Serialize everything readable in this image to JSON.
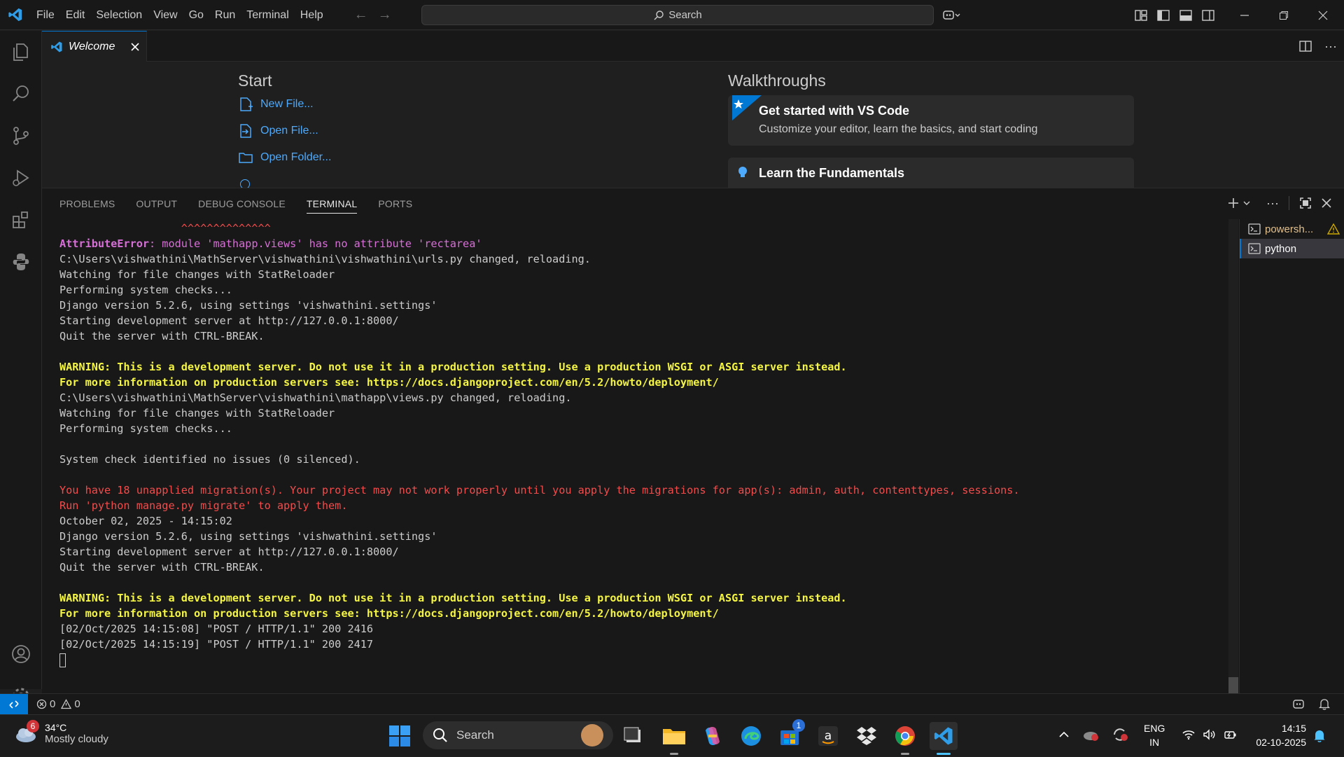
{
  "titlebar": {
    "menu": [
      "File",
      "Edit",
      "Selection",
      "View",
      "Go",
      "Run",
      "Terminal",
      "Help"
    ],
    "search_label": "Search"
  },
  "editor": {
    "tab_label": "Welcome",
    "start_title": "Start",
    "start_links": [
      "New File...",
      "Open File...",
      "Open Folder..."
    ],
    "walkthroughs_title": "Walkthroughs",
    "walkthroughs": [
      {
        "title": "Get started with VS Code",
        "desc": "Customize your editor, learn the basics, and start coding"
      },
      {
        "title": "Learn the Fundamentals",
        "desc": ""
      }
    ]
  },
  "panel": {
    "tabs": [
      "PROBLEMS",
      "OUTPUT",
      "DEBUG CONSOLE",
      "TERMINAL",
      "PORTS"
    ],
    "active_tab": "TERMINAL",
    "terminals": [
      "powersh...",
      "python"
    ],
    "lines": {
      "carets": "                   ^^^^^^^^^^^^^^",
      "err_name": "AttributeError",
      "err_msg": ": module 'mathapp.views' has no attribute 'rectarea'",
      "l1": "C:\\Users\\vishwathini\\MathServer\\vishwathini\\vishwathini\\urls.py changed, reloading.",
      "l2": "Watching for file changes with StatReloader",
      "l3": "Performing system checks...",
      "l4": "Django version 5.2.6, using settings 'vishwathini.settings'",
      "l5": "Starting development server at http://127.0.0.1:8000/",
      "l6": "Quit the server with CTRL-BREAK.",
      "w1": "WARNING: This is a development server. Do not use it in a production setting. Use a production WSGI or ASGI server instead.",
      "w2": "For more information on production servers see: https://docs.djangoproject.com/en/5.2/howto/deployment/",
      "l7": "C:\\Users\\vishwathini\\MathServer\\vishwathini\\mathapp\\views.py changed, reloading.",
      "l8": "Watching for file changes with StatReloader",
      "l9": "Performing system checks...",
      "l10": "System check identified no issues (0 silenced).",
      "m1": "You have 18 unapplied migration(s). Your project may not work properly until you apply the migrations for app(s): admin, auth, contenttypes, sessions.",
      "m2": "Run 'python manage.py migrate' to apply them.",
      "l11": "October 02, 2025 - 14:15:02",
      "l12": "Django version 5.2.6, using settings 'vishwathini.settings'",
      "l13": "Starting development server at http://127.0.0.1:8000/",
      "l14": "Quit the server with CTRL-BREAK.",
      "w3": "WARNING: This is a development server. Do not use it in a production setting. Use a production WSGI or ASGI server instead.",
      "w4": "For more information on production servers see: https://docs.djangoproject.com/en/5.2/howto/deployment/",
      "p1": "[02/Oct/2025 14:15:08] \"POST / HTTP/1.1\" 200 2416",
      "p2": "[02/Oct/2025 14:15:19] \"POST / HTTP/1.1\" 200 2417"
    }
  },
  "statusbar": {
    "errors": "0",
    "warnings": "0"
  },
  "taskbar": {
    "weather_badge": "6",
    "temperature": "34°C",
    "weather": "Mostly cloudy",
    "search_label": "Search",
    "store_badge": "1",
    "lang_line1": "ENG",
    "lang_line2": "IN",
    "time": "14:15",
    "date": "02-10-2025"
  },
  "colors": {
    "accent": "#0078d4",
    "link": "#4daafc",
    "error_red": "#f14c4c",
    "warning_yellow": "#f5f543"
  }
}
